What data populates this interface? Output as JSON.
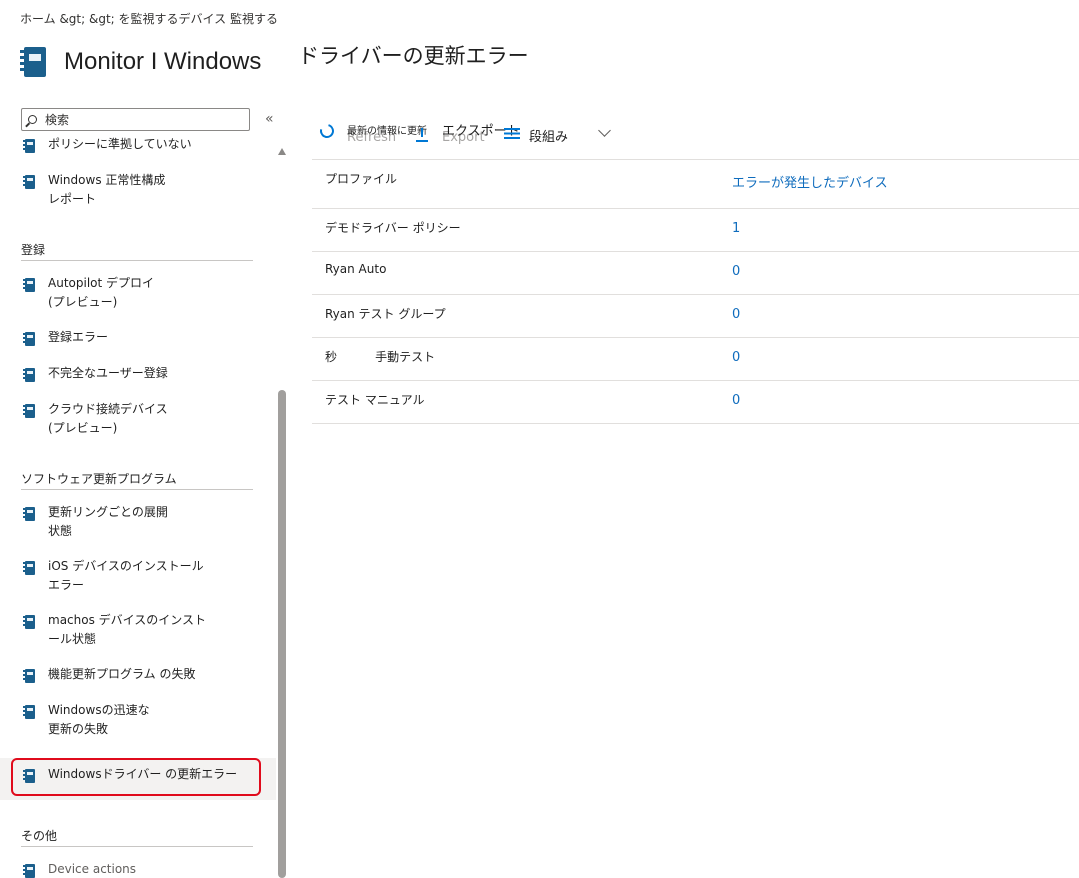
{
  "breadcrumb": "ホーム &gt;  &gt; を監視するデバイス   監視する",
  "header": {
    "app_title": "Monitor I Windows",
    "page_title": "ドライバーの更新エラー"
  },
  "search": {
    "placeholder": "検索"
  },
  "sidebar": {
    "collapse_label": "«",
    "items_top": [
      {
        "label": "ポリシーに準拠していない"
      },
      {
        "label": "Windows 正常性構成\nレポート"
      }
    ],
    "sections": [
      {
        "title": "登録",
        "items": [
          {
            "label": "Autopilot デプロイ\n(プレビュー)"
          },
          {
            "label": "登録エラー"
          },
          {
            "label": "不完全なユーザー登録"
          },
          {
            "label": "クラウド接続デバイス\n(プレビュー)"
          }
        ]
      },
      {
        "title": "ソフトウェア更新プログラム",
        "items": [
          {
            "label": "更新リングごとの展開\n状態"
          },
          {
            "label": "iOS デバイスのインストール\nエラー"
          },
          {
            "label": "machos デバイスのインスト\nール状態"
          },
          {
            "label": "機能更新プログラム の失敗"
          },
          {
            "label": "Windowsの迅速な\n更新の失敗"
          },
          {
            "label": "Windowsドライバー の更新エラー"
          }
        ]
      },
      {
        "title": "その他",
        "items": [
          {
            "label": "Device actions"
          }
        ]
      }
    ]
  },
  "toolbar": {
    "refresh_label": "最新の情報に更新",
    "refresh_ghost": "Refresh",
    "export_label": "エクスポート",
    "export_ghost": "Export",
    "columns_label": "段組み"
  },
  "table": {
    "columns": [
      "プロファイル",
      "エラーが発生したデバイス"
    ],
    "rows": [
      {
        "profile": "デモドライバー ポリシー",
        "devices": "1"
      },
      {
        "profile": "Ryan Auto",
        "devices": "0"
      },
      {
        "profile": "Ryan テスト グループ",
        "devices": "0"
      },
      {
        "profile": "秒          手動テスト",
        "devices": "0"
      },
      {
        "profile": "テスト マニュアル",
        "devices": "0"
      }
    ]
  },
  "colors": {
    "accent": "#0078d4",
    "link": "#0f6cbd",
    "icon": "#1b5f8c",
    "highlight": "#e00b1c"
  }
}
